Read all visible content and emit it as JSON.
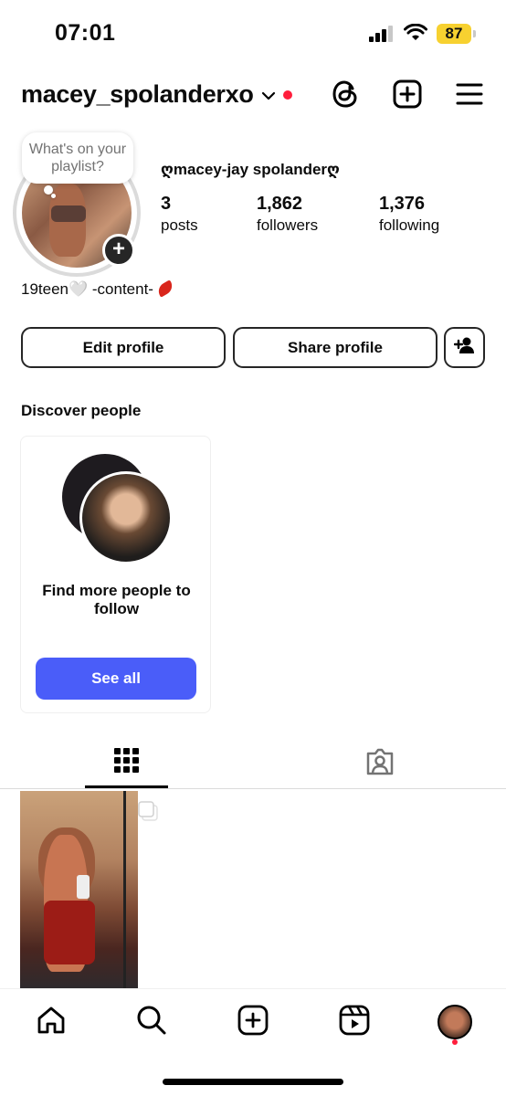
{
  "status_bar": {
    "time": "07:01",
    "battery": "87"
  },
  "header": {
    "username": "macey_spolanderxo",
    "icons": [
      "chevron-down-icon",
      "threads-icon",
      "create-post-icon",
      "menu-icon"
    ]
  },
  "profile": {
    "note": "What's on your playlist?",
    "full_name": "ღmacey-jay spolanderღ",
    "stats": [
      {
        "value": "3",
        "label": "posts"
      },
      {
        "value": "1,862",
        "label": "followers"
      },
      {
        "value": "1,376",
        "label": "following"
      }
    ],
    "bio": "19teen🤍 -content-"
  },
  "buttons": {
    "edit_profile": "Edit profile",
    "share_profile": "Share profile"
  },
  "discover": {
    "title": "Discover people",
    "card_text": "Find more people to follow",
    "see_all": "See all"
  },
  "tabs": [
    "grid-icon",
    "tagged-icon"
  ],
  "bottom_nav": [
    "home-icon",
    "search-icon",
    "create-icon",
    "reels-icon",
    "profile-avatar"
  ],
  "colors": {
    "accent": "#4a5df9",
    "notification": "#ff1e3c",
    "battery": "#f7d130"
  }
}
